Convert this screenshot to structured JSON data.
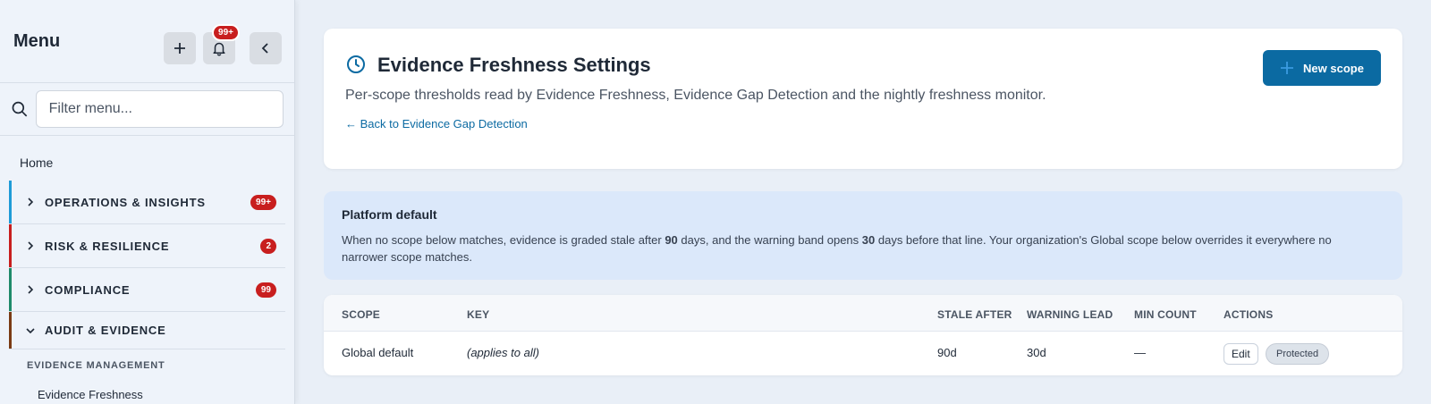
{
  "sidebar": {
    "title": "Menu",
    "notification_count": "99+",
    "filter_placeholder": "Filter menu...",
    "home_label": "Home",
    "sections": [
      {
        "label": "OPERATIONS & INSIGHTS",
        "count": "99+",
        "color": "#1e9bd7",
        "expanded": false
      },
      {
        "label": "RISK & RESILIENCE",
        "count": "2",
        "color": "#c81e1e",
        "expanded": false
      },
      {
        "label": "COMPLIANCE",
        "count": "99",
        "color": "#1e8a6a",
        "expanded": false
      },
      {
        "label": "AUDIT & EVIDENCE",
        "count": "",
        "color": "#7a3b14",
        "expanded": true
      }
    ],
    "subsection_label": "EVIDENCE MANAGEMENT",
    "active_item": "Evidence Freshness"
  },
  "header": {
    "title": "Evidence Freshness Settings",
    "subtitle": "Per-scope thresholds read by Evidence Freshness, Evidence Gap Detection and the nightly freshness monitor.",
    "back_link": "← Back to Evidence Gap Detection",
    "new_scope_label": "New scope"
  },
  "platform_default": {
    "title": "Platform default",
    "text_pre": "When no scope below matches, evidence is graded stale after ",
    "stale_days": "90",
    "text_mid": " days, and the warning band opens ",
    "warning_days": "30",
    "text_post": " days before that line. Your organization's Global scope below overrides it everywhere no narrower scope matches."
  },
  "table": {
    "columns": [
      "SCOPE",
      "KEY",
      "STALE AFTER",
      "WARNING LEAD",
      "MIN COUNT",
      "ACTIONS"
    ],
    "rows": [
      {
        "scope": "Global default",
        "key": "(applies to all)",
        "stale_after": "90d",
        "warning_lead": "30d",
        "min_count": "—",
        "edit_label": "Edit",
        "status_label": "Protected"
      }
    ]
  },
  "colors": {
    "accent": "#0b6aa2",
    "badge": "#c81e1e",
    "default_panel": "#dbe8fa"
  }
}
